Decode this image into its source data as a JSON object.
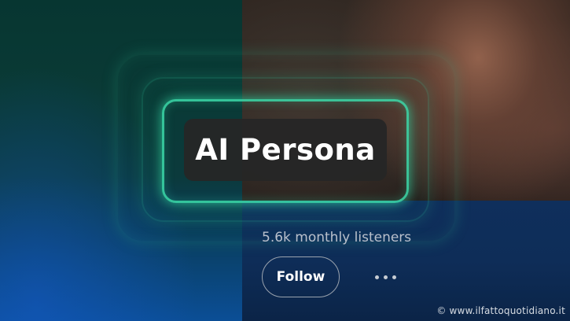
{
  "card": {
    "title": "AI Persona",
    "listeners": "5.6k monthly listeners",
    "follow_label": "Follow",
    "more_icon": "more-horizontal-icon"
  },
  "watermark": "© www.ilfattoquotidiano.it",
  "colors": {
    "glow": "#3cdcaa",
    "chip_bg": "#262626",
    "button_border": "#9aa3ae"
  }
}
